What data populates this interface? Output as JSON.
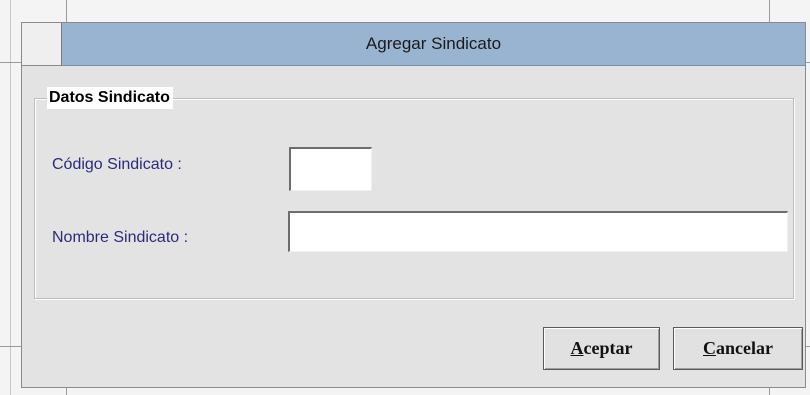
{
  "dialog": {
    "title": "Agregar Sindicato"
  },
  "group": {
    "legend": "Datos Sindicato"
  },
  "fields": {
    "code_label": "Código Sindicato :",
    "code_value": "",
    "name_label": "Nombre Sindicato :",
    "name_value": ""
  },
  "buttons": {
    "accept_mnemonic": "A",
    "accept_rest": "ceptar",
    "cancel_mnemonic": "C",
    "cancel_rest": "ancelar"
  },
  "colors": {
    "titlebar": "#99b4d1",
    "dialog_bg": "#e3e3e3",
    "label_text": "#2b2b7a"
  }
}
